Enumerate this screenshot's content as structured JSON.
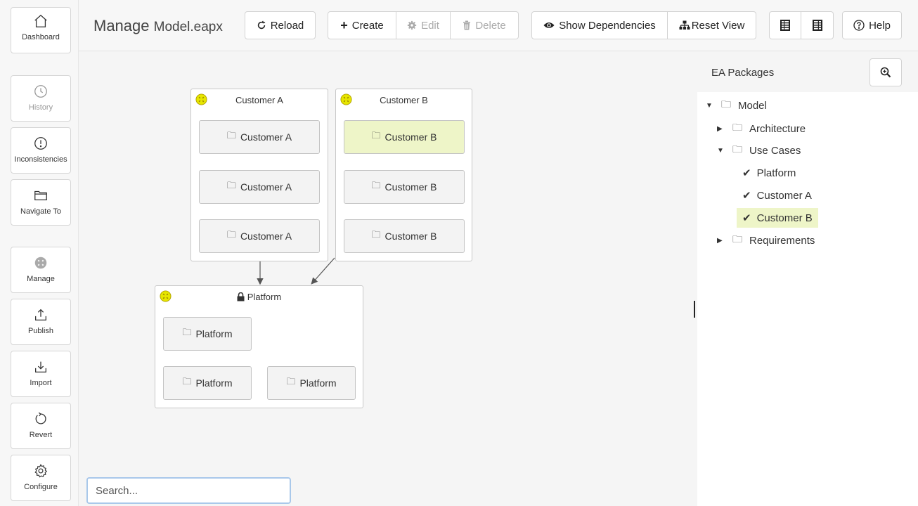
{
  "sidebar": {
    "items": [
      {
        "label": "Dashboard",
        "icon": "home-icon"
      },
      {
        "label": "History",
        "icon": "clock-icon"
      },
      {
        "label": "Inconsistencies",
        "icon": "alert-circle-icon"
      },
      {
        "label": "Navigate To",
        "icon": "folder-icon"
      },
      {
        "label": "Manage",
        "icon": "manage-icon"
      },
      {
        "label": "Publish",
        "icon": "upload-icon"
      },
      {
        "label": "Import",
        "icon": "download-icon"
      },
      {
        "label": "Revert",
        "icon": "revert-icon"
      },
      {
        "label": "Configure",
        "icon": "gear-icon"
      }
    ]
  },
  "header": {
    "title": "Manage",
    "subtitle": "Model.eapx"
  },
  "toolbar": {
    "reload": "Reload",
    "create": "Create",
    "edit": "Edit",
    "delete": "Delete",
    "show_dependencies": "Show Dependencies",
    "reset_view": "Reset View",
    "help": "Help"
  },
  "diagram": {
    "customer_a": {
      "title": "Customer A",
      "elements": [
        "Customer A",
        "Customer A",
        "Customer A"
      ]
    },
    "customer_b": {
      "title": "Customer B",
      "elements": [
        "Customer B",
        "Customer B",
        "Customer B"
      ]
    },
    "platform": {
      "title": "Platform",
      "elements": [
        "Platform",
        "Platform",
        "Platform"
      ]
    },
    "colors": {
      "selected_fill": "#eef5c8",
      "status_badge": "#e6e600"
    }
  },
  "search": {
    "placeholder": "Search..."
  },
  "packages": {
    "title": "EA Packages",
    "tree": [
      {
        "label": "Model",
        "expanded": true
      },
      {
        "label": "Architecture",
        "expanded": false
      },
      {
        "label": "Use Cases",
        "expanded": true
      },
      {
        "label": "Platform",
        "checked": true
      },
      {
        "label": "Customer A",
        "checked": true
      },
      {
        "label": "Customer B",
        "checked": true,
        "selected": true
      },
      {
        "label": "Requirements",
        "expanded": false
      }
    ]
  }
}
